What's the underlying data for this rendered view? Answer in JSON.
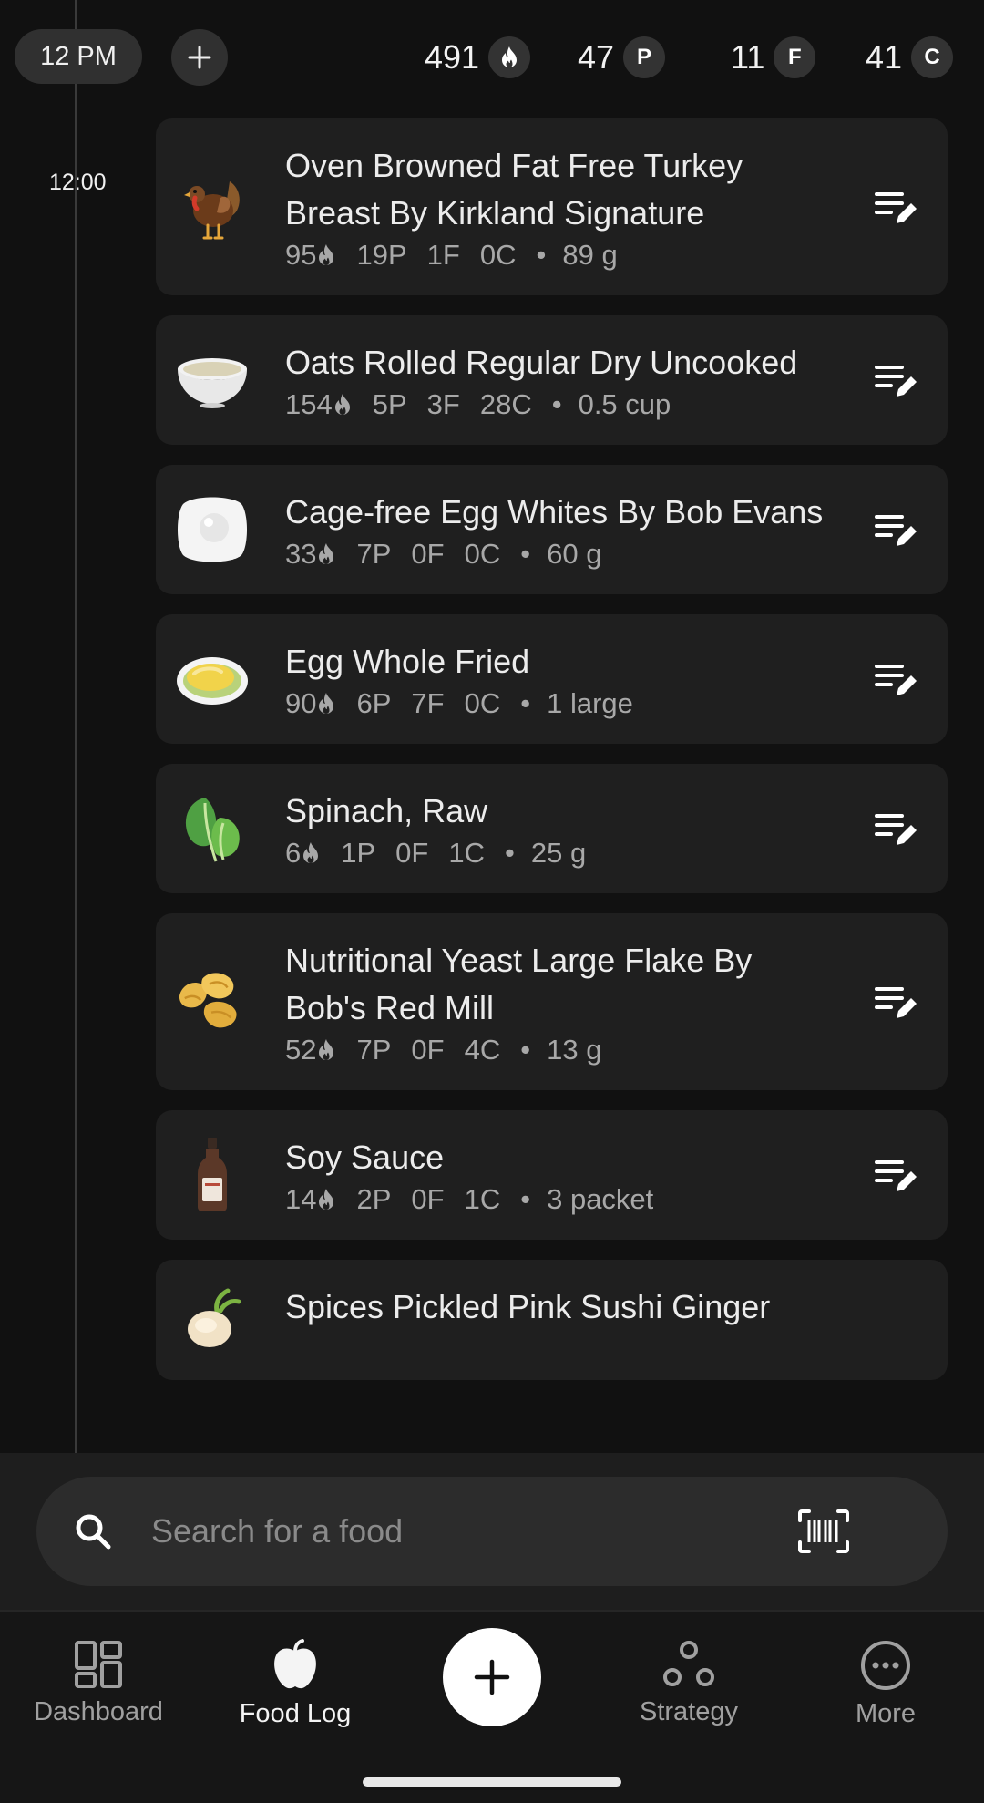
{
  "header": {
    "time_pill": "12 PM",
    "totals": [
      {
        "value": "491",
        "badge_type": "flame"
      },
      {
        "value": "47",
        "badge": "P"
      },
      {
        "value": "11",
        "badge": "F"
      },
      {
        "value": "41",
        "badge": "C"
      }
    ]
  },
  "timeline": {
    "time_label": "12:00"
  },
  "entries": [
    {
      "name": "Oven Browned Fat Free Turkey Breast By Kirkland Signature",
      "cal": "95",
      "protein": "19P",
      "fat": "1F",
      "carbs": "0C",
      "portion": "89 g",
      "icon": "turkey-icon"
    },
    {
      "name": "Oats Rolled Regular Dry Uncooked",
      "cal": "154",
      "protein": "5P",
      "fat": "3F",
      "carbs": "28C",
      "portion": "0.5 cup",
      "icon": "oat-bowl-icon"
    },
    {
      "name": "Cage-free Egg Whites By Bob Evans",
      "cal": "33",
      "protein": "7P",
      "fat": "0F",
      "carbs": "0C",
      "portion": "60 g",
      "icon": "egg-icon"
    },
    {
      "name": "Egg Whole Fried",
      "cal": "90",
      "protein": "6P",
      "fat": "7F",
      "carbs": "0C",
      "portion": "1 large",
      "icon": "fried-egg-icon"
    },
    {
      "name": "Spinach, Raw",
      "cal": "6",
      "protein": "1P",
      "fat": "0F",
      "carbs": "1C",
      "portion": "25 g",
      "icon": "spinach-icon"
    },
    {
      "name": "Nutritional Yeast Large Flake By Bob's Red Mill",
      "cal": "52",
      "protein": "7P",
      "fat": "0F",
      "carbs": "4C",
      "portion": "13 g",
      "icon": "yeast-flakes-icon"
    },
    {
      "name": "Soy Sauce",
      "cal": "14",
      "protein": "2P",
      "fat": "0F",
      "carbs": "1C",
      "portion": "3 packet",
      "icon": "soy-sauce-bottle-icon"
    },
    {
      "name": "Spices Pickled Pink Sushi Ginger",
      "icon": "ginger-icon"
    }
  ],
  "search": {
    "placeholder": "Search for a food"
  },
  "nav": {
    "dashboard": "Dashboard",
    "food_log": "Food Log",
    "strategy": "Strategy",
    "more": "More"
  },
  "colors": {
    "background": "#111111",
    "card": "#1f1f1f",
    "pill": "#303030",
    "text": "#ececec",
    "muted": "#a8a8a8"
  }
}
